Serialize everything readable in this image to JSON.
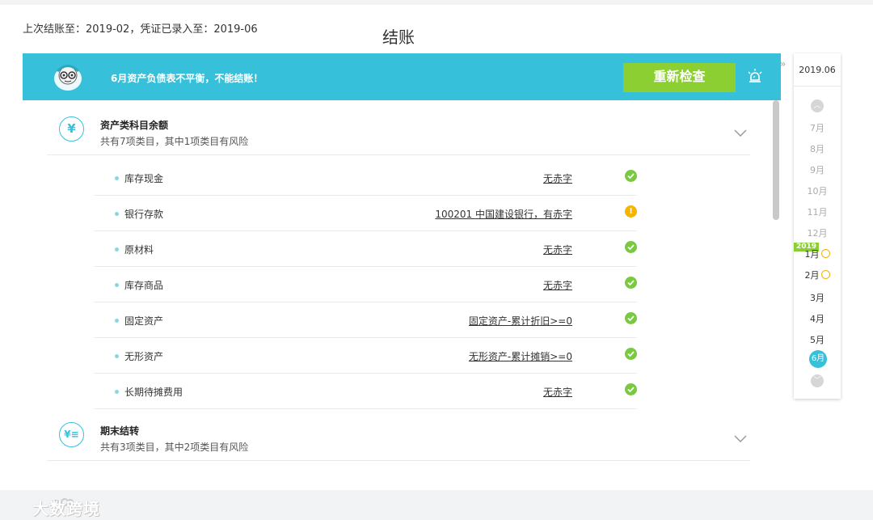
{
  "header": {
    "last_close": "上次结账至：2019-02，凭证已录入至：2019-06",
    "title": "结账"
  },
  "banner": {
    "message": "6月资产负债表不平衡，不能结账！",
    "recheck_label": "重新检查",
    "background_color": "#37c0d9",
    "button_color": "#8ccf33"
  },
  "sections": [
    {
      "icon": "yen-icon",
      "title": "资产类科目余额",
      "subtitle": "共有7项类目，其中1项类目有风险",
      "items": [
        {
          "name": "库存现金",
          "status": "无赤字",
          "state": "ok"
        },
        {
          "name": "银行存款",
          "status": "100201 中国建设银行，有赤字",
          "state": "warning"
        },
        {
          "name": "原材料",
          "status": "无赤字",
          "state": "ok"
        },
        {
          "name": "库存商品",
          "status": "无赤字",
          "state": "ok"
        },
        {
          "name": "固定资产",
          "status": "固定资产-累计折旧>=0",
          "state": "ok"
        },
        {
          "name": "无形资产",
          "status": "无形资产-累计摊销>=0",
          "state": "ok"
        },
        {
          "name": "长期待摊费用",
          "status": "无赤字",
          "state": "ok"
        }
      ]
    },
    {
      "icon": "ledger-icon",
      "title": "期末结转",
      "subtitle": "共有3项类目，其中2项类目有风险"
    }
  ],
  "period_panel": {
    "current": "2019.06",
    "year_tag": "2019",
    "months": [
      "7月",
      "8月",
      "9月",
      "10月",
      "11月",
      "12月",
      "1月",
      "2月",
      "3月",
      "4月",
      "5月",
      "6月"
    ],
    "selected": "6月"
  },
  "watermark": {
    "text": "大数跨境"
  },
  "colors": {
    "accent": "#37c0d9",
    "ok": "#7ac943",
    "warning": "#f5b400"
  }
}
